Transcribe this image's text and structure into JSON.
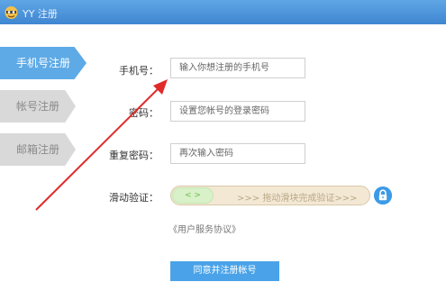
{
  "window": {
    "title": "YY 注册"
  },
  "sidebar": {
    "tabs": [
      {
        "label": "手机号注册",
        "active": true
      },
      {
        "label": "帐号注册",
        "active": false
      },
      {
        "label": "邮箱注册",
        "active": false
      }
    ]
  },
  "form": {
    "phone": {
      "label": "手机号：",
      "placeholder": "输入你想注册的手机号"
    },
    "password": {
      "label": "密码：",
      "placeholder": "设置您帐号的登录密码"
    },
    "repeat_password": {
      "label": "重复密码：",
      "placeholder": "再次输入密码"
    },
    "slide_verify": {
      "label": "滑动验证：",
      "handle": "< >",
      "hint": ">>> 拖动滑块完成验证>>>"
    },
    "protocol": "《用户服务协议》",
    "submit_label": "同意并注册帐号"
  },
  "colors": {
    "titlebar": "#3f86d1",
    "active_tab": "#5eaae6",
    "inactive_tab": "#d9d9d9",
    "submit": "#4aa3e8",
    "annotation_arrow": "#e02a2a"
  }
}
